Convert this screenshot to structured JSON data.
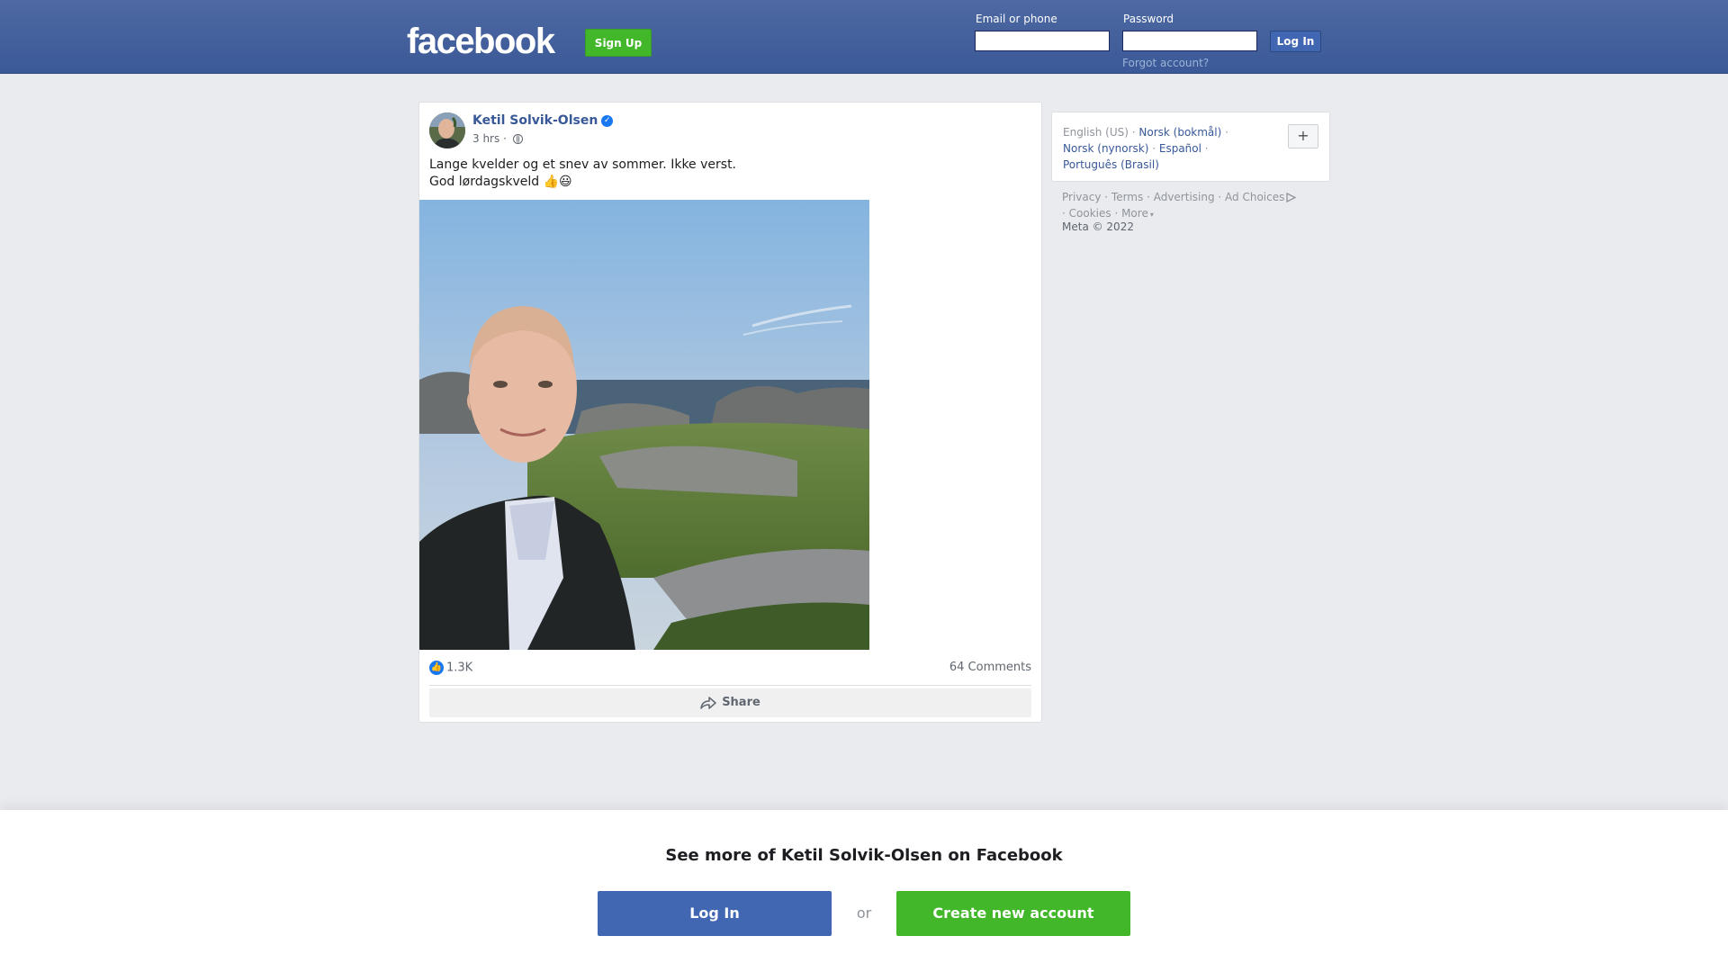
{
  "header": {
    "logo": "facebook",
    "signup_label": "Sign Up",
    "email_label": "Email or phone",
    "password_label": "Password",
    "login_label": "Log In",
    "forgot_label": "Forgot account?"
  },
  "post": {
    "author": "Ketil Solvik-Olsen",
    "time": "3 hrs",
    "separator": "·",
    "text_line1": "Lange kvelder og et snev av sommer. Ikke verst.",
    "text_line2": "God lørdagskveld 👍😃",
    "reactions_count": "1.3K",
    "comments": "64 Comments",
    "share_label": "Share"
  },
  "sidebar": {
    "languages": [
      {
        "label": "English (US)",
        "current": true
      },
      {
        "label": "Norsk (bokmål)",
        "current": false
      },
      {
        "label": "Norsk (nynorsk)",
        "current": false
      },
      {
        "label": "Español",
        "current": false
      },
      {
        "label": "Português (Brasil)",
        "current": false
      }
    ],
    "plus_label": "+",
    "footer_links": [
      "Privacy",
      "Terms",
      "Advertising",
      "Ad Choices",
      "Cookies",
      "More"
    ],
    "copyright": "Meta © 2022"
  },
  "banner": {
    "title": "See more of Ketil Solvik-Olsen on Facebook",
    "login_label": "Log In",
    "or_label": "or",
    "create_label": "Create new account"
  },
  "colors": {
    "brand_blue": "#3b5998",
    "button_blue": "#4267b2",
    "signup_green": "#42b72a",
    "link_blue": "#385898"
  }
}
